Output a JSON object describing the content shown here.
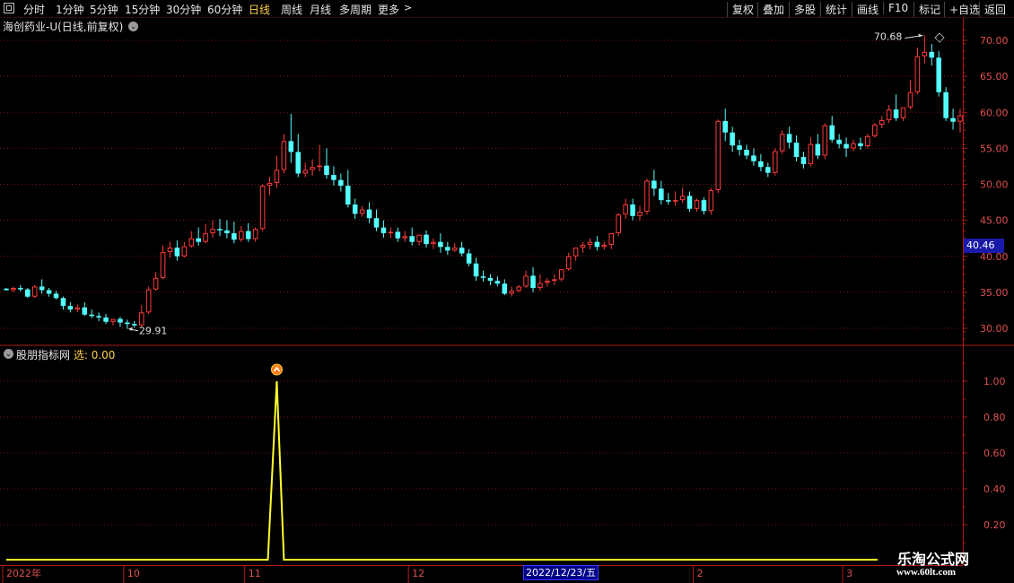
{
  "toolbar": {
    "left": [
      {
        "label": "分时"
      },
      {
        "label": "1分钟"
      },
      {
        "label": "5分钟"
      },
      {
        "label": "15分钟"
      },
      {
        "label": "30分钟"
      },
      {
        "label": "60分钟"
      },
      {
        "label": "日线",
        "active": true
      },
      {
        "label": "周线"
      },
      {
        "label": "月线"
      },
      {
        "label": "多周期"
      },
      {
        "label": "更多"
      }
    ],
    "more_arrow": ">",
    "right": [
      {
        "label": "复权"
      },
      {
        "label": "叠加"
      },
      {
        "label": "多股"
      },
      {
        "label": "统计"
      },
      {
        "label": "画线"
      },
      {
        "label": "F10"
      },
      {
        "label": "标记"
      },
      {
        "label": "+自选"
      },
      {
        "label": "返回"
      }
    ]
  },
  "title": "海创药业-U(日线,前复权)",
  "sub_panel": {
    "title": "股朋指标网",
    "label": "选:",
    "value": "0.00"
  },
  "colors": {
    "up": "#ff3b3b",
    "down": "#54ffff",
    "grid": "#7a1515",
    "axis": "#b01818",
    "indicator": "#ffff2a",
    "label": "#e05050"
  },
  "chart_data": [
    {
      "type": "candlestick",
      "ylim": [
        28,
        72
      ],
      "y_ticks": [
        "70.00",
        "65.00",
        "60.00",
        "55.00",
        "50.00",
        "45.00",
        "40.00",
        "35.00",
        "30.00"
      ],
      "annotations": [
        {
          "text": "70.68"
        },
        {
          "text": "29.91"
        }
      ],
      "last_price": "40.46",
      "candles": [
        [
          35.5,
          35.6,
          35.3,
          35.2
        ],
        [
          35.3,
          35.8,
          35.6,
          35.0
        ],
        [
          35.6,
          36.0,
          35.4,
          35.1
        ],
        [
          35.4,
          35.6,
          34.4,
          34.2
        ],
        [
          34.4,
          36.0,
          35.8,
          34.2
        ],
        [
          35.8,
          36.8,
          35.3,
          34.8
        ],
        [
          35.3,
          35.6,
          34.8,
          34.4
        ],
        [
          34.8,
          35.2,
          34.2,
          34.0
        ],
        [
          34.2,
          34.4,
          33.1,
          32.6
        ],
        [
          33.1,
          33.6,
          32.6,
          32.2
        ],
        [
          32.6,
          33.3,
          32.9,
          32.2
        ],
        [
          32.9,
          33.6,
          31.9,
          31.7
        ],
        [
          31.9,
          32.6,
          31.7,
          31.4
        ],
        [
          31.7,
          32.2,
          31.5,
          31.0
        ],
        [
          31.5,
          32.0,
          30.9,
          30.6
        ],
        [
          30.9,
          31.2,
          31.3,
          30.4
        ],
        [
          31.3,
          31.6,
          30.8,
          30.2
        ],
        [
          30.8,
          31.2,
          30.6,
          29.91
        ],
        [
          30.6,
          31.0,
          30.4,
          30.1
        ],
        [
          30.4,
          33.2,
          32.2,
          30.2
        ],
        [
          32.2,
          35.8,
          35.4,
          32.0
        ],
        [
          35.4,
          37.8,
          37.0,
          35.2
        ],
        [
          37.0,
          41.5,
          40.6,
          36.8
        ],
        [
          40.6,
          42.0,
          41.2,
          39.8
        ],
        [
          41.2,
          42.2,
          40.0,
          39.4
        ],
        [
          40.0,
          42.0,
          41.4,
          39.8
        ],
        [
          41.4,
          43.5,
          42.5,
          41.2
        ],
        [
          42.5,
          44.0,
          42.0,
          41.5
        ],
        [
          42.0,
          44.5,
          43.2,
          41.8
        ],
        [
          43.2,
          45.0,
          43.8,
          42.6
        ],
        [
          43.8,
          45.2,
          43.6,
          42.8
        ],
        [
          43.6,
          45.0,
          43.2,
          42.5
        ],
        [
          43.2,
          44.8,
          42.3,
          41.8
        ],
        [
          42.3,
          44.2,
          43.5,
          42.0
        ],
        [
          43.5,
          44.6,
          42.4,
          42.0
        ],
        [
          42.4,
          44.0,
          43.8,
          42.0
        ],
        [
          43.8,
          50.0,
          49.8,
          43.5
        ],
        [
          49.8,
          51.0,
          50.2,
          48.5
        ],
        [
          50.2,
          54.0,
          52.0,
          49.5
        ],
        [
          52.0,
          57.0,
          56.0,
          51.5
        ],
        [
          56.0,
          59.8,
          54.5,
          53.0
        ],
        [
          54.5,
          57.0,
          51.5,
          51.0
        ],
        [
          51.5,
          53.0,
          52.0,
          51.0
        ],
        [
          52.0,
          53.5,
          52.4,
          51.2
        ],
        [
          52.4,
          55.5,
          52.6,
          51.8
        ],
        [
          52.6,
          55.0,
          51.3,
          50.8
        ],
        [
          51.3,
          52.5,
          50.6,
          49.8
        ],
        [
          50.6,
          51.5,
          49.8,
          49.0
        ],
        [
          49.8,
          52.0,
          47.2,
          46.8
        ],
        [
          47.2,
          48.0,
          45.9,
          45.2
        ],
        [
          45.9,
          47.0,
          46.5,
          45.5
        ],
        [
          46.5,
          47.5,
          45.3,
          44.6
        ],
        [
          45.3,
          46.5,
          44.0,
          43.5
        ],
        [
          44.0,
          45.0,
          43.2,
          42.6
        ],
        [
          43.2,
          44.0,
          43.4,
          42.5
        ],
        [
          43.4,
          44.0,
          42.5,
          42.0
        ],
        [
          42.5,
          43.5,
          42.8,
          42.0
        ],
        [
          42.8,
          44.0,
          42.0,
          41.5
        ],
        [
          42.0,
          43.0,
          43.0,
          41.5
        ],
        [
          43.0,
          43.6,
          41.7,
          41.2
        ],
        [
          41.7,
          42.5,
          42.0,
          41.0
        ],
        [
          42.0,
          43.2,
          41.3,
          40.5
        ],
        [
          41.3,
          42.0,
          40.8,
          40.2
        ],
        [
          40.8,
          41.8,
          41.2,
          40.6
        ],
        [
          41.2,
          42.0,
          40.4,
          40.0
        ],
        [
          40.4,
          41.0,
          39.0,
          38.6
        ],
        [
          39.0,
          39.8,
          37.2,
          36.6
        ],
        [
          37.2,
          38.0,
          37.0,
          36.5
        ],
        [
          37.0,
          37.5,
          36.6,
          36.0
        ],
        [
          36.6,
          37.2,
          36.2,
          35.8
        ],
        [
          36.2,
          36.8,
          34.8,
          34.6
        ],
        [
          34.8,
          35.8,
          35.2,
          34.4
        ],
        [
          35.2,
          36.0,
          35.8,
          35.0
        ],
        [
          35.8,
          38.0,
          37.3,
          35.6
        ],
        [
          37.3,
          38.5,
          35.6,
          35.0
        ],
        [
          35.6,
          37.5,
          36.3,
          35.2
        ],
        [
          36.3,
          37.0,
          36.6,
          35.8
        ],
        [
          36.6,
          37.5,
          36.8,
          36.0
        ],
        [
          36.8,
          38.0,
          38.2,
          36.5
        ],
        [
          38.2,
          40.5,
          40.0,
          38.0
        ],
        [
          40.0,
          41.0,
          41.2,
          39.4
        ],
        [
          41.2,
          42.0,
          41.6,
          40.5
        ],
        [
          41.6,
          42.5,
          42.0,
          41.0
        ],
        [
          42.0,
          42.8,
          41.3,
          40.8
        ],
        [
          41.3,
          42.0,
          41.6,
          40.9
        ],
        [
          41.6,
          42.5,
          43.2,
          41.0
        ],
        [
          43.2,
          46.0,
          45.8,
          42.8
        ],
        [
          45.8,
          48.0,
          47.2,
          45.2
        ],
        [
          47.2,
          48.0,
          45.6,
          45.0
        ],
        [
          45.6,
          47.0,
          46.2,
          45.0
        ],
        [
          46.2,
          50.8,
          50.5,
          45.8
        ],
        [
          50.5,
          52.0,
          49.4,
          48.4
        ],
        [
          49.4,
          50.5,
          47.8,
          47.2
        ],
        [
          47.8,
          48.8,
          47.6,
          47.2
        ],
        [
          47.6,
          49.0,
          47.8,
          47.0
        ],
        [
          47.8,
          49.5,
          48.4,
          47.4
        ],
        [
          48.4,
          49.0,
          46.6,
          46.2
        ],
        [
          46.6,
          48.0,
          47.8,
          46.2
        ],
        [
          47.8,
          48.2,
          46.3,
          45.8
        ],
        [
          46.3,
          49.5,
          49.2,
          45.8
        ],
        [
          49.2,
          59.0,
          58.8,
          48.8
        ],
        [
          58.8,
          60.5,
          57.2,
          56.0
        ],
        [
          57.2,
          58.0,
          55.4,
          54.5
        ],
        [
          55.4,
          56.2,
          54.8,
          54.0
        ],
        [
          54.8,
          55.5,
          54.0,
          53.5
        ],
        [
          54.0,
          55.0,
          53.2,
          52.6
        ],
        [
          53.2,
          54.2,
          52.4,
          51.8
        ],
        [
          52.4,
          53.0,
          51.6,
          51.0
        ],
        [
          51.6,
          55.0,
          54.6,
          51.2
        ],
        [
          54.6,
          57.5,
          57.0,
          54.2
        ],
        [
          57.0,
          58.0,
          55.8,
          55.0
        ],
        [
          55.8,
          56.8,
          53.8,
          53.2
        ],
        [
          53.8,
          54.5,
          52.8,
          52.2
        ],
        [
          52.8,
          56.5,
          55.6,
          52.5
        ],
        [
          55.6,
          57.0,
          54.0,
          53.5
        ],
        [
          54.0,
          58.5,
          58.2,
          53.5
        ],
        [
          58.2,
          59.5,
          56.2,
          55.8
        ],
        [
          56.2,
          57.0,
          55.6,
          55.0
        ],
        [
          55.6,
          56.5,
          55.0,
          53.8
        ],
        [
          55.0,
          56.2,
          55.7,
          54.6
        ],
        [
          55.7,
          56.5,
          55.3,
          54.8
        ],
        [
          55.3,
          57.0,
          56.7,
          55.0
        ],
        [
          56.7,
          58.5,
          58.3,
          56.5
        ],
        [
          58.3,
          59.5,
          58.9,
          57.8
        ],
        [
          58.9,
          61.0,
          60.4,
          58.5
        ],
        [
          60.4,
          62.5,
          59.2,
          58.8
        ],
        [
          59.2,
          60.0,
          60.7,
          58.8
        ],
        [
          60.7,
          64.5,
          62.8,
          60.4
        ],
        [
          62.8,
          69.0,
          67.8,
          62.5
        ],
        [
          67.8,
          70.68,
          68.4,
          66.8
        ],
        [
          68.4,
          69.5,
          67.6,
          66.5
        ],
        [
          67.6,
          68.5,
          62.8,
          62.2
        ],
        [
          62.8,
          63.5,
          59.2,
          58.8
        ],
        [
          59.2,
          60.5,
          58.7,
          57.6
        ],
        [
          58.7,
          60.5,
          59.6,
          57.2
        ]
      ]
    },
    {
      "type": "line",
      "ylim": [
        0,
        1.2
      ],
      "y_ticks": [
        "1.00",
        "0.80",
        "0.60",
        "0.40",
        "0.20"
      ],
      "signal_index": 38,
      "x_labels": [
        {
          "text": "2022年",
          "index": 0
        },
        {
          "text": "10",
          "index": 17
        },
        {
          "text": "11",
          "index": 34
        },
        {
          "text": "12",
          "index": 57
        },
        {
          "text": "2",
          "index": 97
        },
        {
          "text": "3",
          "index": 118
        }
      ],
      "crosshair_date": "2022/12/23/五"
    }
  ],
  "watermark": {
    "line1": "乐淘公式网",
    "line2": "www.60lt.com"
  }
}
